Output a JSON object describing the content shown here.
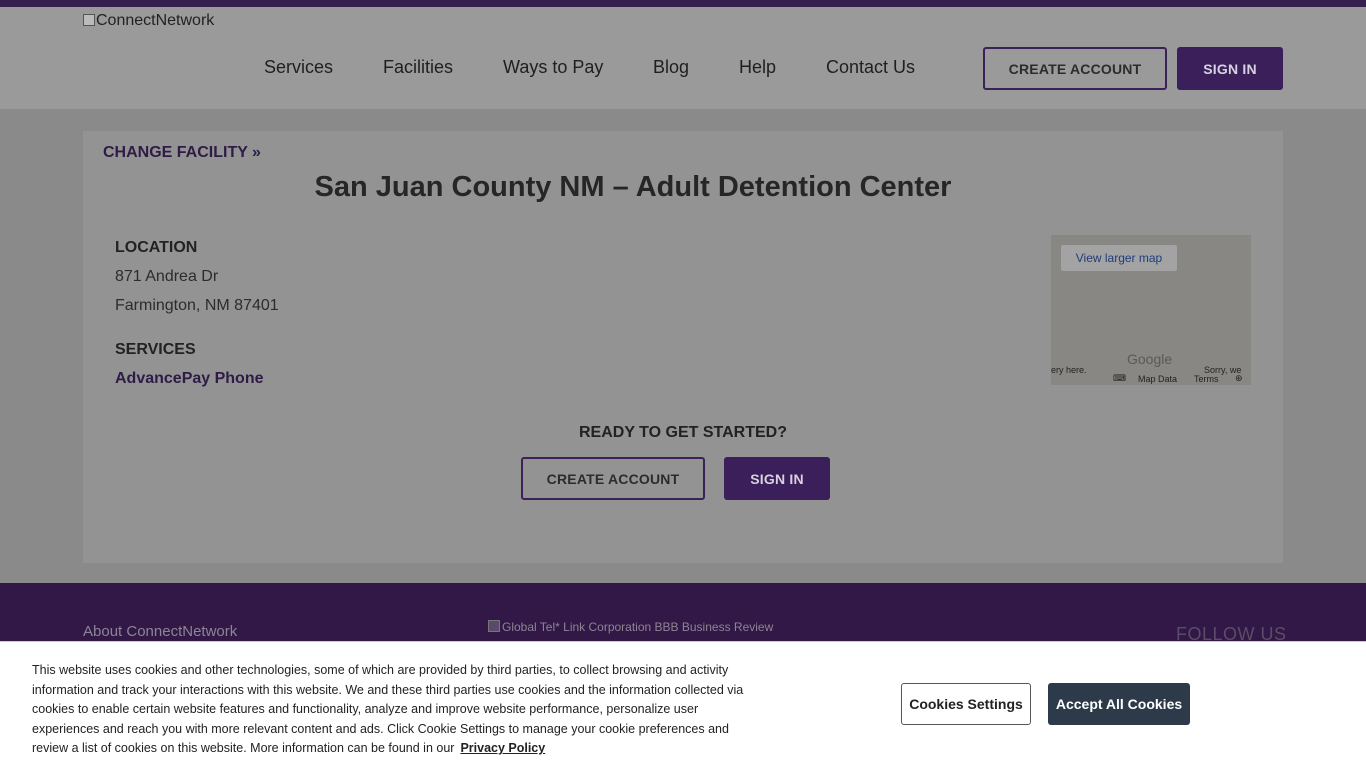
{
  "header": {
    "logo_alt": "ConnectNetwork",
    "nav": [
      "Services",
      "Facilities",
      "Ways to Pay",
      "Blog",
      "Help",
      "Contact Us"
    ],
    "create_account": "CREATE ACCOUNT",
    "sign_in": "SIGN IN"
  },
  "facility": {
    "change_link": "CHANGE FACILITY »",
    "title": "San Juan County NM – Adult Detention Center",
    "location_label": "LOCATION",
    "address_line1": "871 Andrea Dr",
    "address_line2": "Farmington, NM 87401",
    "services_label": "SERVICES",
    "service_link": "AdvancePay Phone",
    "ready_text": "READY TO GET STARTED?",
    "create_account": "CREATE ACCOUNT",
    "sign_in": "SIGN IN"
  },
  "map": {
    "view_larger": "View larger map",
    "google": "Google",
    "imagery_text": "ery here.",
    "sorry_text": "Sorry, we",
    "map_data": "Map Data",
    "terms": "Terms"
  },
  "footer": {
    "about": "About ConnectNetwork",
    "bbb_alt": "Global Tel* Link Corporation BBB Business Review",
    "follow": "FOLLOW US"
  },
  "cookie": {
    "text": "This website uses cookies and other technologies, some of which are provided by third parties, to collect browsing and activity information and track your interactions with this website. We and these third parties use cookies and the information collected via cookies to enable certain website features and functionality, analyze and improve website performance, personalize user experiences and reach you with more relevant content and ads. Click Cookie Settings to manage your cookie preferences and review a list of cookies on this website. More information can be found in our",
    "privacy_link": "Privacy Policy",
    "settings_button": "Cookies Settings",
    "accept_button": "Accept All Cookies"
  }
}
